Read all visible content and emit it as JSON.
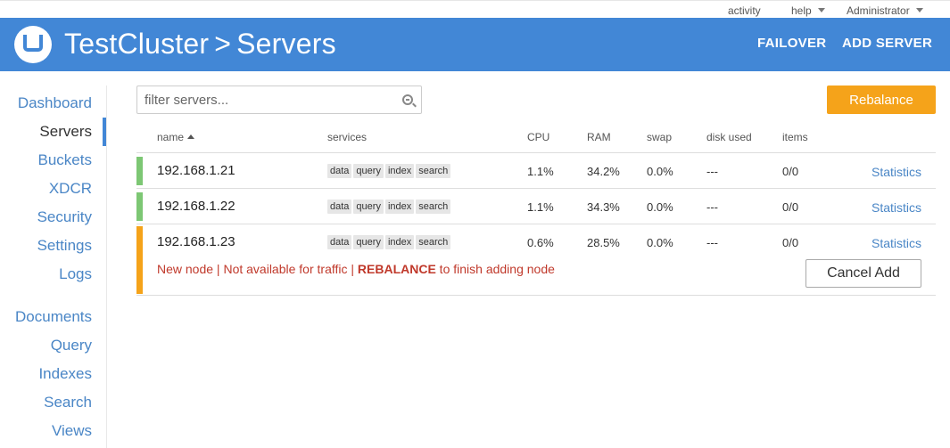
{
  "topbar": {
    "activity": "activity",
    "help": "help",
    "user": "Administrator"
  },
  "header": {
    "cluster": "TestCluster",
    "separator": ">",
    "page": "Servers",
    "failover": "FAILOVER",
    "add_server": "ADD SERVER",
    "logo_icon": "couchbase-logo-icon",
    "color": "#4287d6"
  },
  "sidebar": {
    "items": [
      {
        "label": "Dashboard"
      },
      {
        "label": "Servers"
      },
      {
        "label": "Buckets"
      },
      {
        "label": "XDCR"
      },
      {
        "label": "Security"
      },
      {
        "label": "Settings"
      },
      {
        "label": "Logs"
      },
      {
        "label": "Documents"
      },
      {
        "label": "Query"
      },
      {
        "label": "Indexes"
      },
      {
        "label": "Search"
      },
      {
        "label": "Views"
      }
    ],
    "active": "Servers"
  },
  "filter": {
    "placeholder": "filter servers..."
  },
  "rebalance_label": "Rebalance",
  "rebalance_color": "#f5a31a",
  "columns": {
    "name": "name",
    "services": "services",
    "cpu": "CPU",
    "ram": "RAM",
    "swap": "swap",
    "disk": "disk used",
    "items": "items"
  },
  "servers": [
    {
      "ip": "192.168.1.21",
      "services": [
        "data",
        "query",
        "index",
        "search"
      ],
      "cpu": "1.1%",
      "ram": "34.2%",
      "swap": "0.0%",
      "disk": "---",
      "items": "0/0",
      "stats": "Statistics",
      "status_color": "#7dc774"
    },
    {
      "ip": "192.168.1.22",
      "services": [
        "data",
        "query",
        "index",
        "search"
      ],
      "cpu": "1.1%",
      "ram": "34.3%",
      "swap": "0.0%",
      "disk": "---",
      "items": "0/0",
      "stats": "Statistics",
      "status_color": "#7dc774"
    },
    {
      "ip": "192.168.1.23",
      "services": [
        "data",
        "query",
        "index",
        "search"
      ],
      "cpu": "0.6%",
      "ram": "28.5%",
      "swap": "0.0%",
      "disk": "---",
      "items": "0/0",
      "stats": "Statistics",
      "status_color": "#f5a31a",
      "warning_pre": "New node | Not available for traffic | ",
      "warning_bold": "REBALANCE",
      "warning_post": " to finish adding node",
      "cancel_label": "Cancel Add"
    }
  ]
}
